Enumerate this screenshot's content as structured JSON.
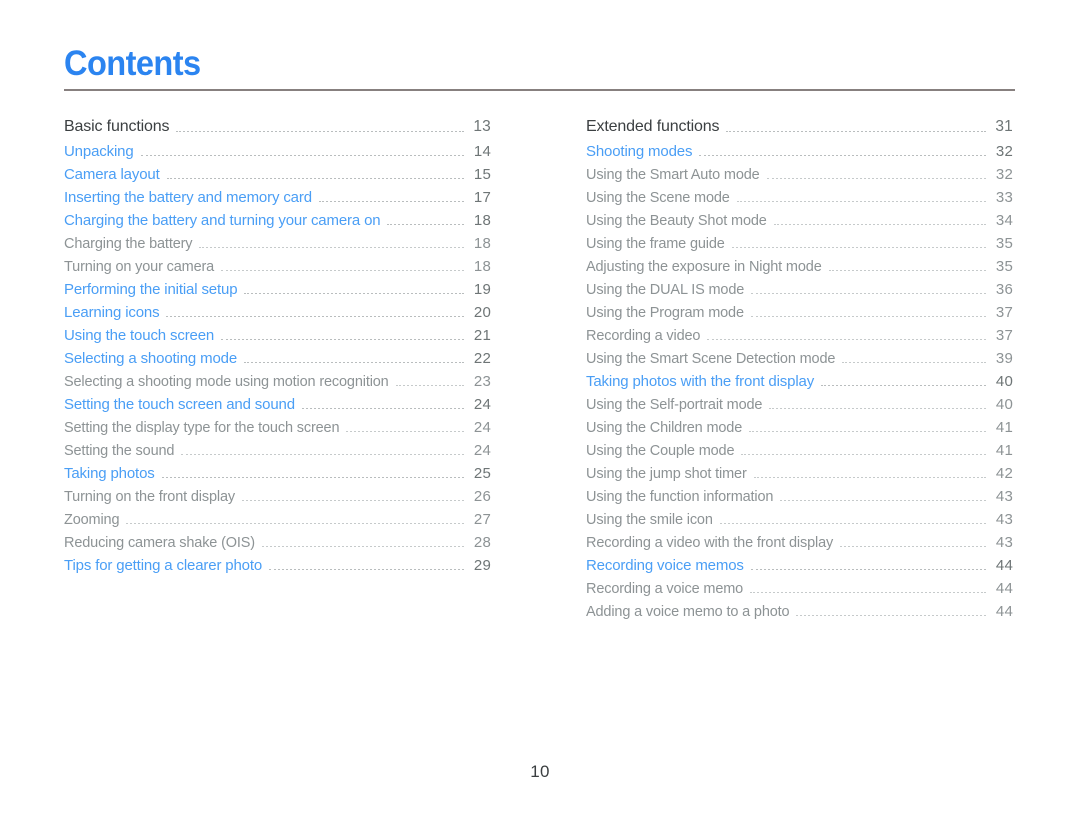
{
  "document": {
    "title": "Contents",
    "page_number": "10",
    "accent_color": "#2b84f0",
    "link_color": "#4a9ef5",
    "subentry_color": "#8d9395",
    "heading_color": "#3b3f41",
    "rule_color": "#87807f"
  },
  "columns": [
    {
      "id": "left-column",
      "entries": [
        {
          "label": "Basic functions",
          "page": "13",
          "level": "head"
        },
        {
          "label": "Unpacking",
          "page": "14",
          "level": "main"
        },
        {
          "label": "Camera layout",
          "page": "15",
          "level": "main"
        },
        {
          "label": "Inserting the battery and memory card",
          "page": "17",
          "level": "main"
        },
        {
          "label": "Charging the battery and turning your camera on",
          "page": "18",
          "level": "main"
        },
        {
          "label": "Charging the battery",
          "page": "18",
          "level": "sub"
        },
        {
          "label": "Turning on your camera",
          "page": "18",
          "level": "sub"
        },
        {
          "label": "Performing the initial setup",
          "page": "19",
          "level": "main"
        },
        {
          "label": "Learning icons",
          "page": "20",
          "level": "main"
        },
        {
          "label": "Using the touch screen",
          "page": "21",
          "level": "main"
        },
        {
          "label": "Selecting a shooting mode",
          "page": "22",
          "level": "main"
        },
        {
          "label": "Selecting a shooting mode using motion recognition",
          "page": "23",
          "level": "sub"
        },
        {
          "label": "Setting the touch screen and sound",
          "page": "24",
          "level": "main"
        },
        {
          "label": "Setting the display type for the touch screen",
          "page": "24",
          "level": "sub"
        },
        {
          "label": "Setting the sound",
          "page": "24",
          "level": "sub"
        },
        {
          "label": "Taking photos",
          "page": "25",
          "level": "main"
        },
        {
          "label": "Turning on the front display",
          "page": "26",
          "level": "sub"
        },
        {
          "label": "Zooming",
          "page": "27",
          "level": "sub"
        },
        {
          "label": "Reducing camera shake (OIS)",
          "page": "28",
          "level": "sub"
        },
        {
          "label": "Tips for getting a clearer photo",
          "page": "29",
          "level": "main"
        }
      ]
    },
    {
      "id": "right-column",
      "entries": [
        {
          "label": "Extended functions",
          "page": "31",
          "level": "head"
        },
        {
          "label": "Shooting modes",
          "page": "32",
          "level": "main"
        },
        {
          "label": "Using the Smart Auto mode",
          "page": "32",
          "level": "sub"
        },
        {
          "label": "Using the Scene mode",
          "page": "33",
          "level": "sub"
        },
        {
          "label": "Using the Beauty Shot mode",
          "page": "34",
          "level": "sub"
        },
        {
          "label": "Using the frame guide",
          "page": "35",
          "level": "sub"
        },
        {
          "label": "Adjusting the exposure in Night mode",
          "page": "35",
          "level": "sub"
        },
        {
          "label": "Using the DUAL IS mode",
          "page": "36",
          "level": "sub"
        },
        {
          "label": "Using the Program mode",
          "page": "37",
          "level": "sub"
        },
        {
          "label": "Recording a video",
          "page": "37",
          "level": "sub"
        },
        {
          "label": "Using the Smart Scene Detection mode",
          "page": "39",
          "level": "sub"
        },
        {
          "label": "Taking photos with the front display",
          "page": "40",
          "level": "main"
        },
        {
          "label": "Using the Self-portrait mode",
          "page": "40",
          "level": "sub"
        },
        {
          "label": "Using the Children mode",
          "page": "41",
          "level": "sub"
        },
        {
          "label": "Using the Couple mode",
          "page": "41",
          "level": "sub"
        },
        {
          "label": "Using the jump shot timer",
          "page": "42",
          "level": "sub"
        },
        {
          "label": "Using the function information",
          "page": "43",
          "level": "sub"
        },
        {
          "label": "Using the smile icon",
          "page": "43",
          "level": "sub"
        },
        {
          "label": "Recording a video with the front display",
          "page": "43",
          "level": "sub"
        },
        {
          "label": "Recording voice memos",
          "page": "44",
          "level": "main"
        },
        {
          "label": "Recording a voice memo",
          "page": "44",
          "level": "sub"
        },
        {
          "label": "Adding a voice memo to a photo",
          "page": "44",
          "level": "sub"
        }
      ]
    }
  ]
}
